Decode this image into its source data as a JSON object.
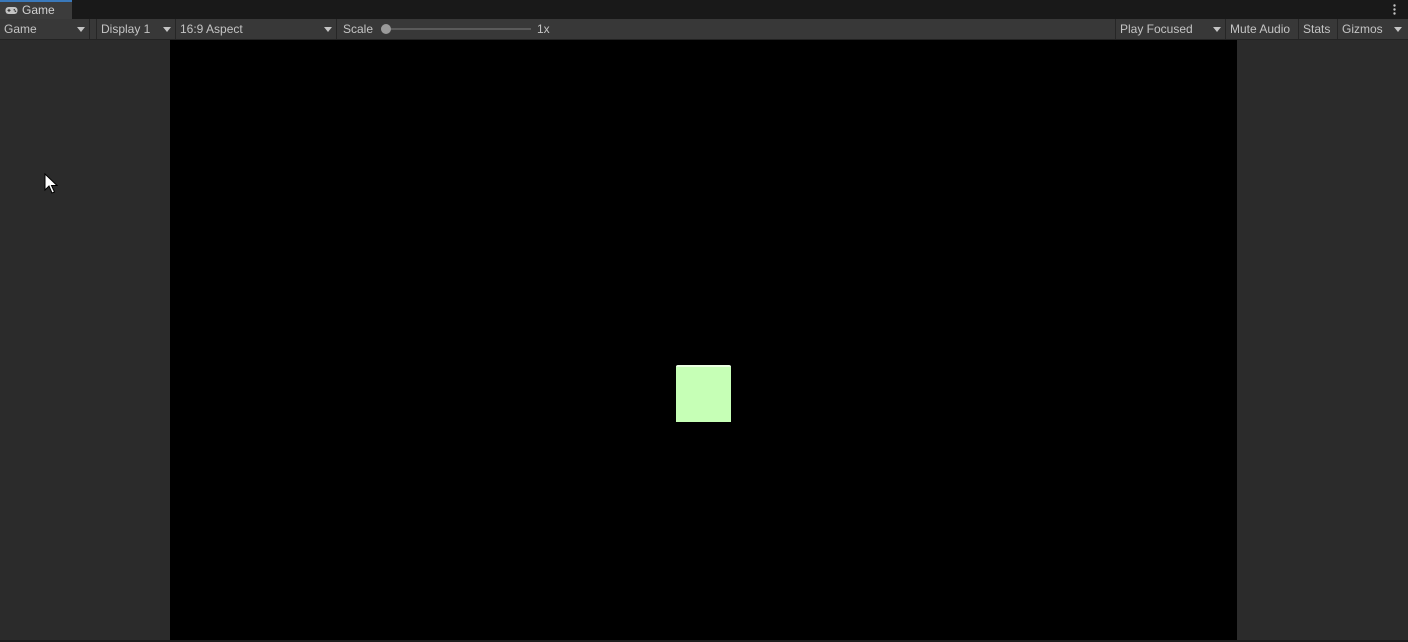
{
  "tab": {
    "title": "Game",
    "icon": "gamepad-icon"
  },
  "toolbar": {
    "view_mode": "Game",
    "display": "Display 1",
    "aspect": "16:9 Aspect",
    "scale_label": "Scale",
    "scale_value": "1x",
    "scale_level": 0,
    "play_mode": "Play Focused",
    "mute_audio": "Mute Audio",
    "stats": "Stats",
    "gizmos": "Gizmos"
  },
  "game": {
    "background_color": "#000000",
    "cube_color": "#c6ffb6"
  },
  "colors": {
    "accent": "#3a79bb",
    "panel": "#383838",
    "background": "#282828"
  }
}
